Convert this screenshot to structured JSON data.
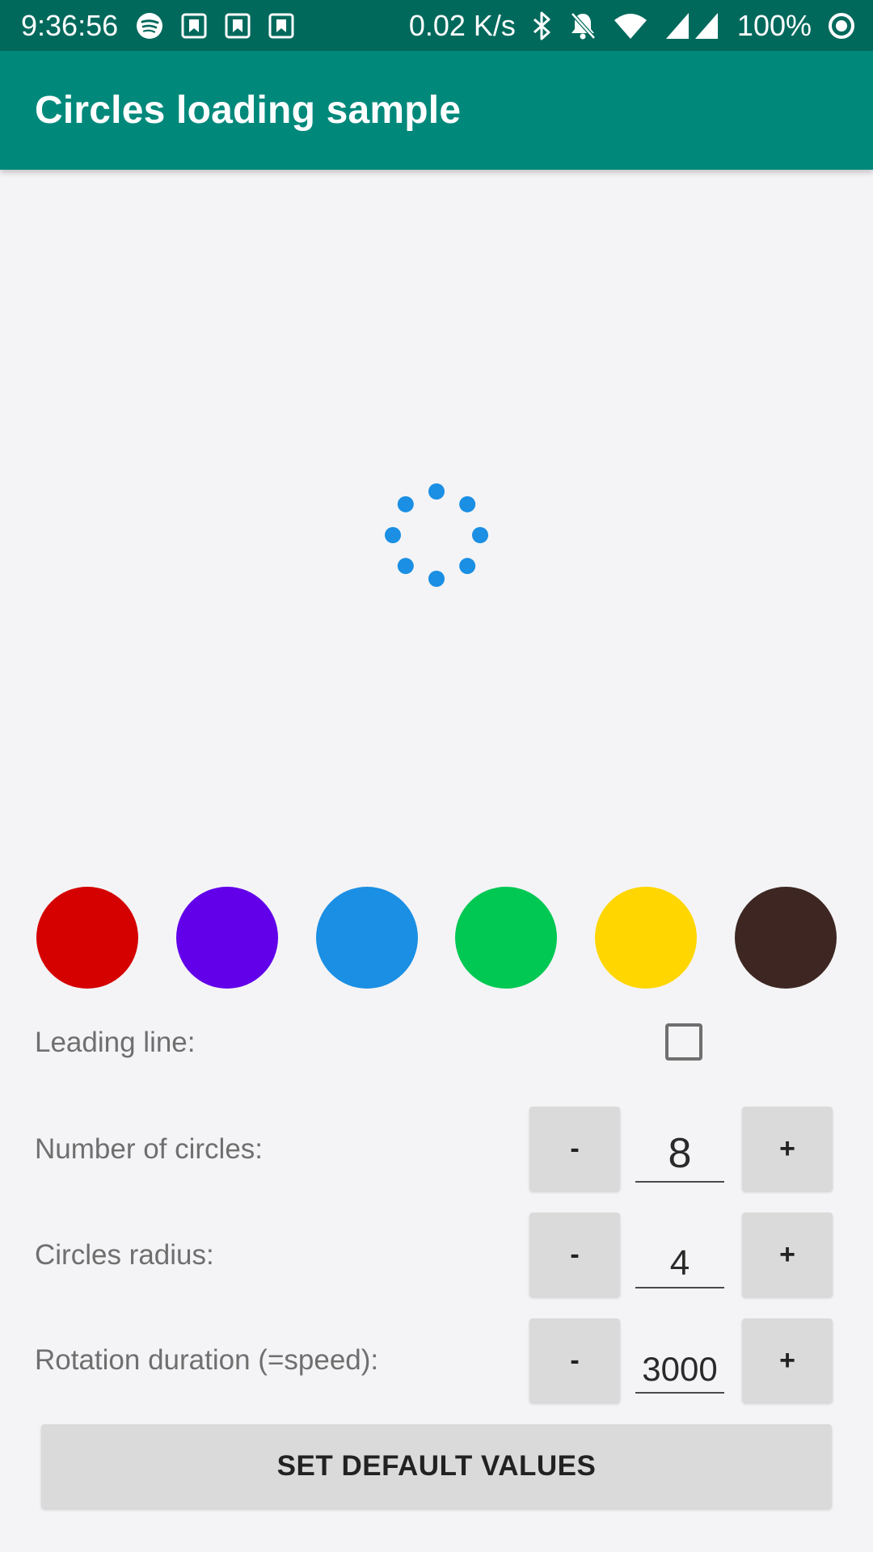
{
  "status_bar": {
    "time": "9:36:56",
    "network_speed": "0.02 K/s",
    "battery": "100%",
    "icons": [
      "spotify-icon",
      "bookmark-notification-icon",
      "bookmark-notification-icon",
      "bookmark-notification-icon",
      "bluetooth-icon",
      "bell-off-icon",
      "wifi-icon",
      "signal-icon",
      "battery-icon"
    ]
  },
  "app_bar": {
    "title": "Circles loading sample"
  },
  "loader": {
    "color": "#1a8fe3",
    "circle_count": 8
  },
  "swatches": [
    {
      "name": "red",
      "color": "#d50000"
    },
    {
      "name": "purple",
      "color": "#6200ea"
    },
    {
      "name": "blue",
      "color": "#1a8fe3"
    },
    {
      "name": "green",
      "color": "#00c853"
    },
    {
      "name": "yellow",
      "color": "#ffd600"
    },
    {
      "name": "brown",
      "color": "#3e2723"
    }
  ],
  "settings": {
    "leading_line_label": "Leading line:",
    "leading_line_checked": false,
    "circles_count_label": "Number of circles:",
    "circles_count_value": "8",
    "radius_label": "Circles radius:",
    "radius_value": "4",
    "duration_label": "Rotation duration (=speed):",
    "duration_value": "3000",
    "minus_label": "-",
    "plus_label": "+"
  },
  "default_button_label": "SET DEFAULT VALUES"
}
